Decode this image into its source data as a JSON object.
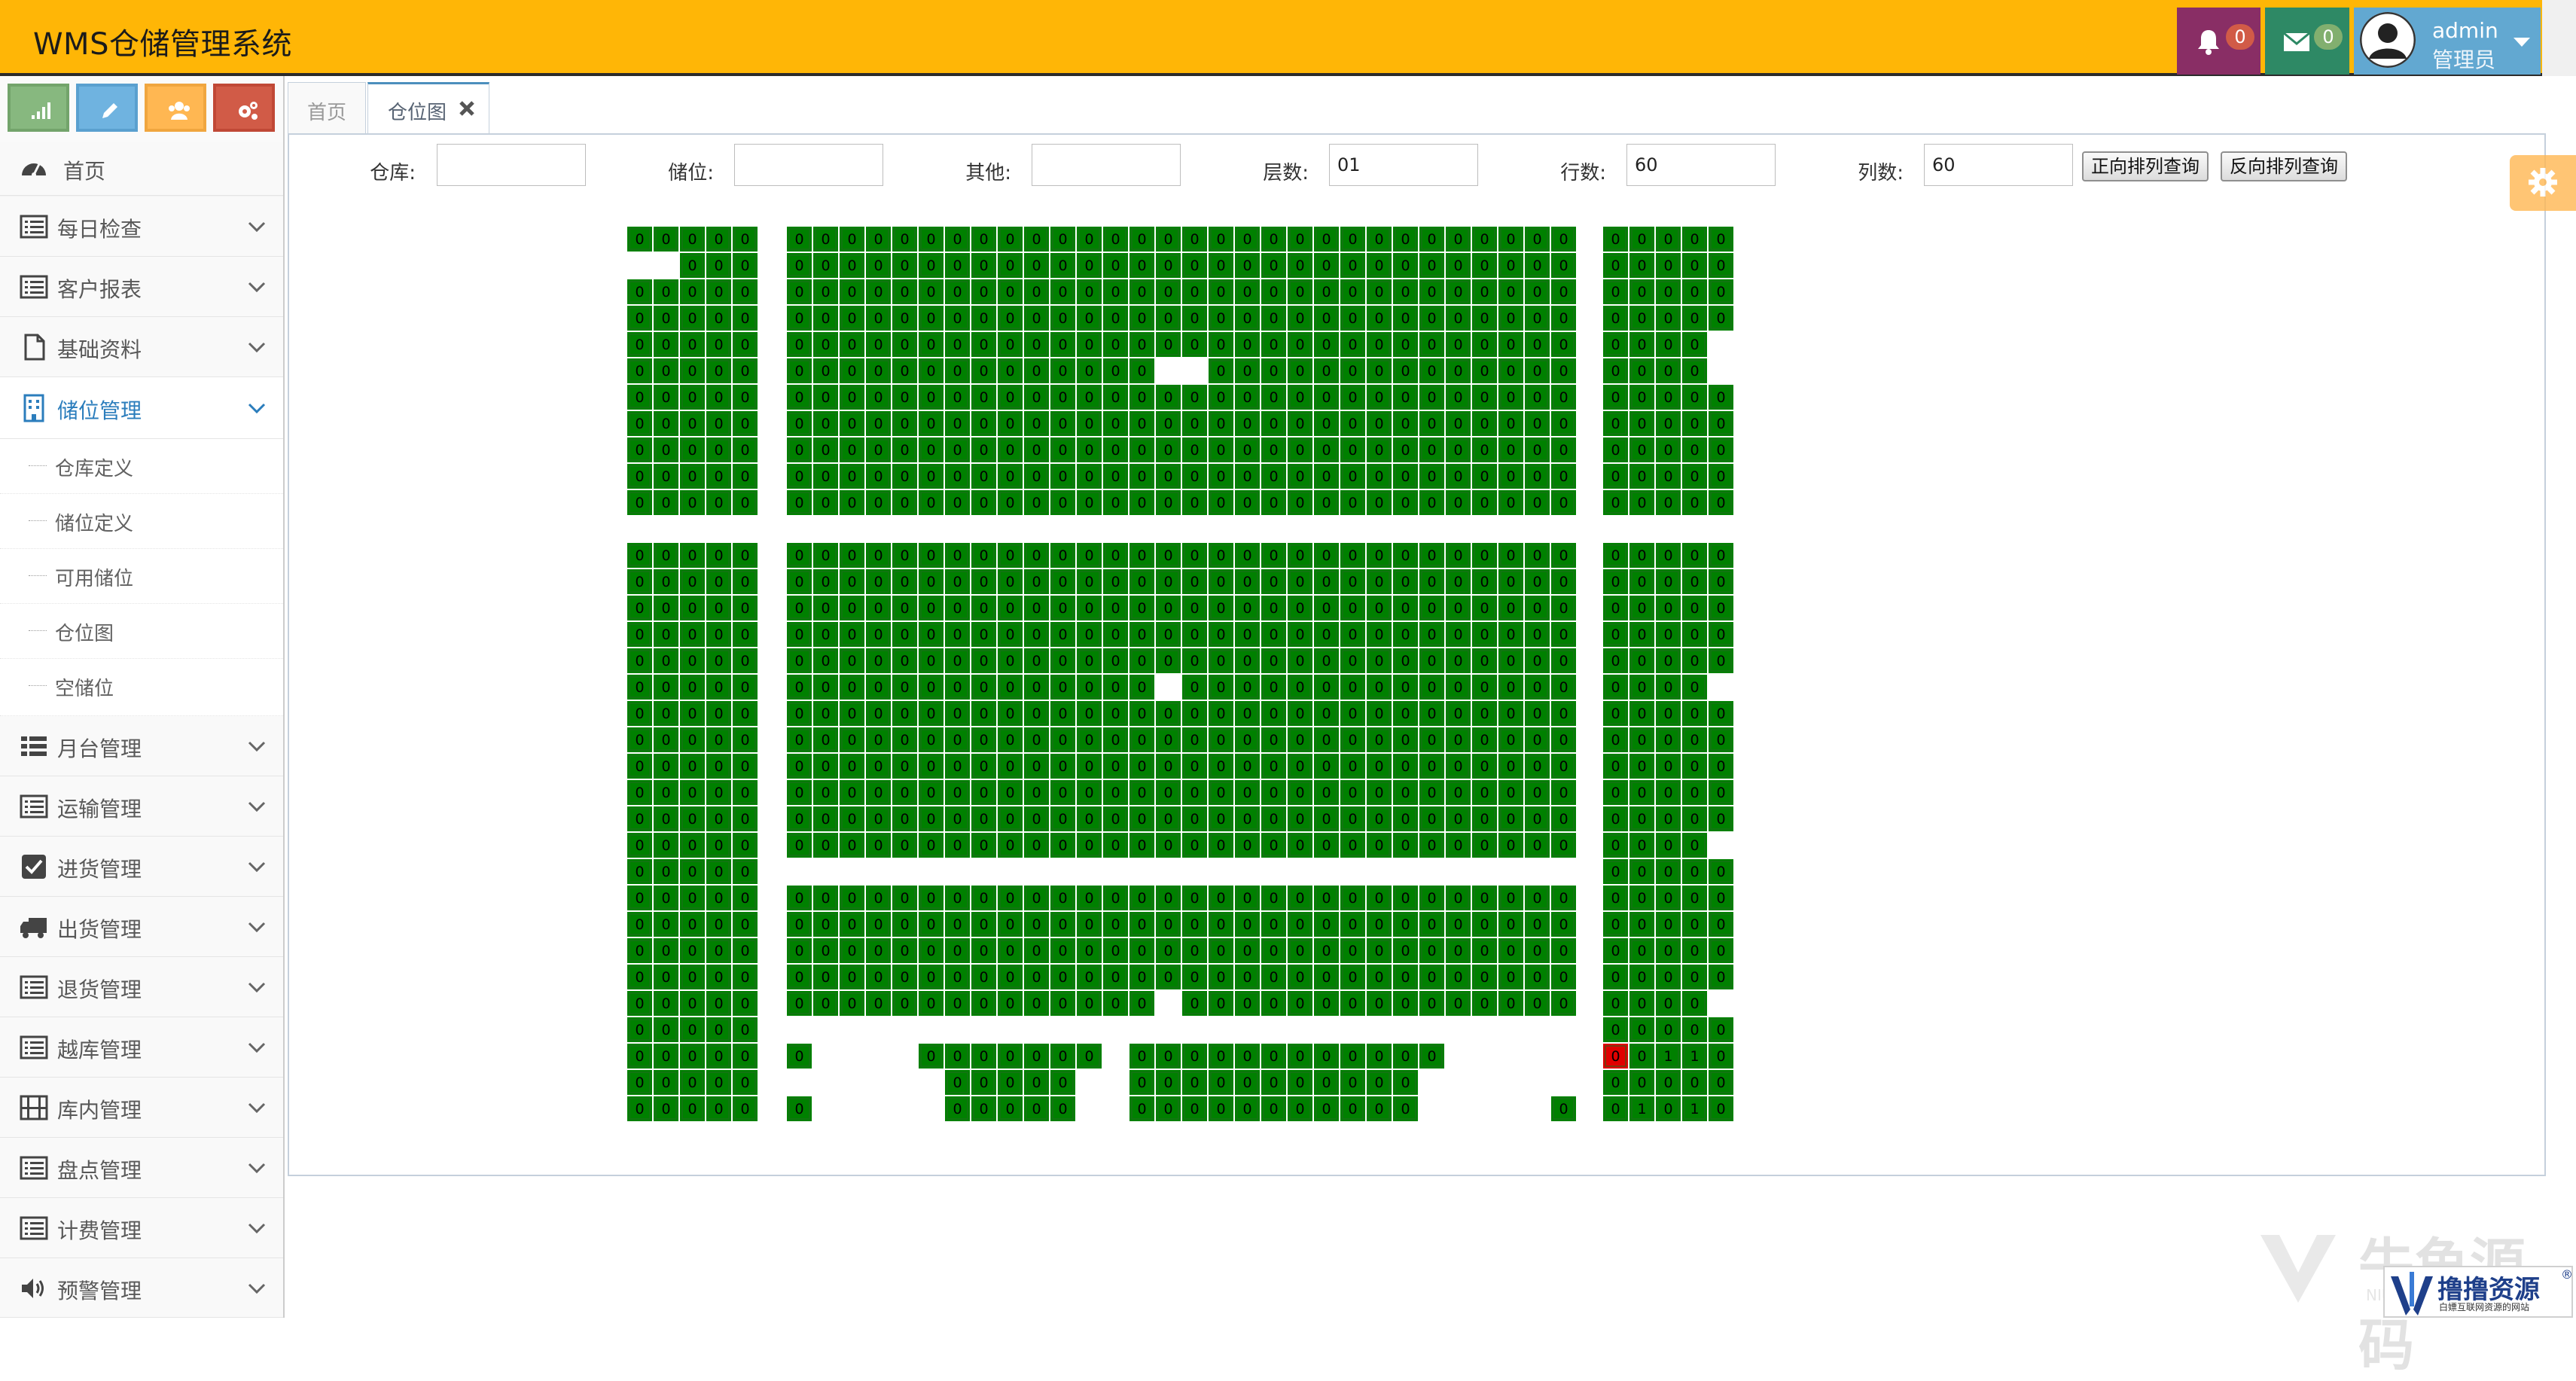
{
  "app": {
    "title": "WMS仓储管理系统"
  },
  "header": {
    "notifications_count": "0",
    "messages_count": "0",
    "user": {
      "name": "admin",
      "role": "管理员"
    },
    "icons": [
      "bell-icon",
      "envelope-icon",
      "user-avatar-icon",
      "caret-down-icon"
    ],
    "colors": {
      "bar": "#ffb606",
      "bell_box": "#892e65",
      "mail_box": "#2e8965",
      "user_box": "#62a8d1"
    }
  },
  "sidebar": {
    "shortcuts": [
      {
        "icon": "signal-icon",
        "color": "#87b87f"
      },
      {
        "icon": "pencil-icon",
        "color": "#6fb3e0"
      },
      {
        "icon": "users-icon",
        "color": "#ffb752"
      },
      {
        "icon": "cogs-icon",
        "color": "#d15b47"
      }
    ],
    "items": [
      {
        "label": "首页",
        "icon": "dashboard-icon"
      },
      {
        "label": "每日检查",
        "icon": "list-alt-icon"
      },
      {
        "label": "客户报表",
        "icon": "list-alt-icon"
      },
      {
        "label": "基础资料",
        "icon": "file-icon"
      },
      {
        "label": "储位管理",
        "icon": "building-icon"
      },
      {
        "label": "月台管理",
        "icon": "list-icon"
      },
      {
        "label": "运输管理",
        "icon": "list-alt-icon"
      },
      {
        "label": "进货管理",
        "icon": "check-square-icon"
      },
      {
        "label": "出货管理",
        "icon": "truck-icon"
      },
      {
        "label": "退货管理",
        "icon": "list-alt-icon"
      },
      {
        "label": "越库管理",
        "icon": "list-alt-icon"
      },
      {
        "label": "库内管理",
        "icon": "film-icon"
      },
      {
        "label": "盘点管理",
        "icon": "list-alt-icon"
      },
      {
        "label": "计费管理",
        "icon": "list-alt-icon"
      },
      {
        "label": "预警管理",
        "icon": "volume-up-icon"
      }
    ],
    "submenu": [
      "仓库定义",
      "储位定义",
      "可用储位",
      "仓位图",
      "空储位"
    ],
    "active_item": "储位管理"
  },
  "tabs": [
    {
      "label": "首页"
    },
    {
      "label": "仓位图"
    }
  ],
  "filters": {
    "warehouse_label": "仓库:",
    "warehouse_value": "",
    "bin_label": "储位:",
    "bin_value": "",
    "other_label": "其他:",
    "other_value": "",
    "layers_label": "层数:",
    "layers_value": "01",
    "rows_label": "行数:",
    "rows_value": "60",
    "cols_label": "列数:",
    "cols_value": "60",
    "forward_button": "正向排列查询",
    "reverse_button": "反向排列查询"
  },
  "location_map": {
    "cell_text": "0",
    "special_cell_text": "1",
    "occupied_color": "#008000",
    "alert_color": "#e00000",
    "blocks": [
      {
        "cols": 5,
        "rows": 11,
        "missing": [
          [
            1,
            0
          ],
          [
            1,
            1
          ]
        ],
        "special": []
      },
      {
        "cols": 30,
        "rows": 11,
        "missing": [
          [
            5,
            14
          ],
          [
            5,
            15
          ]
        ],
        "special": []
      },
      {
        "cols": 5,
        "rows": 11,
        "missing": [
          [
            4,
            4
          ],
          [
            5,
            4
          ]
        ],
        "special": []
      },
      {
        "cols": 5,
        "rows": 22,
        "missing": [],
        "special": []
      },
      {
        "cols": 30,
        "rows": 22,
        "missing": [
          [
            5,
            14
          ],
          [
            12,
            0
          ],
          [
            12,
            1
          ],
          [
            12,
            2
          ],
          [
            12,
            3
          ],
          [
            12,
            4
          ],
          [
            12,
            5
          ],
          [
            12,
            6
          ],
          [
            12,
            7
          ],
          [
            12,
            8
          ],
          [
            12,
            9
          ],
          [
            12,
            10
          ],
          [
            12,
            11
          ],
          [
            12,
            12
          ],
          [
            12,
            13
          ],
          [
            12,
            14
          ],
          [
            12,
            15
          ],
          [
            12,
            16
          ],
          [
            12,
            17
          ],
          [
            12,
            18
          ],
          [
            12,
            19
          ],
          [
            12,
            20
          ],
          [
            12,
            21
          ],
          [
            12,
            22
          ],
          [
            12,
            23
          ],
          [
            12,
            24
          ],
          [
            12,
            25
          ],
          [
            12,
            26
          ],
          [
            12,
            27
          ],
          [
            12,
            28
          ],
          [
            12,
            29
          ],
          [
            17,
            14
          ],
          [
            18,
            0
          ],
          [
            18,
            1
          ],
          [
            18,
            2
          ],
          [
            18,
            3
          ],
          [
            18,
            4
          ],
          [
            18,
            5
          ],
          [
            18,
            6
          ],
          [
            18,
            7
          ],
          [
            18,
            8
          ],
          [
            18,
            9
          ],
          [
            18,
            10
          ],
          [
            18,
            11
          ],
          [
            18,
            12
          ],
          [
            18,
            13
          ],
          [
            18,
            14
          ],
          [
            18,
            15
          ],
          [
            18,
            16
          ],
          [
            18,
            17
          ],
          [
            18,
            18
          ],
          [
            18,
            19
          ],
          [
            18,
            20
          ],
          [
            18,
            21
          ],
          [
            18,
            22
          ],
          [
            18,
            23
          ],
          [
            18,
            24
          ],
          [
            18,
            25
          ],
          [
            18,
            26
          ],
          [
            18,
            27
          ],
          [
            18,
            28
          ],
          [
            18,
            29
          ],
          [
            19,
            1
          ],
          [
            19,
            2
          ],
          [
            19,
            3
          ],
          [
            19,
            4
          ],
          [
            19,
            12
          ],
          [
            19,
            25
          ],
          [
            19,
            26
          ],
          [
            19,
            27
          ],
          [
            19,
            28
          ],
          [
            19,
            29
          ],
          [
            20,
            0
          ],
          [
            20,
            1
          ],
          [
            20,
            2
          ],
          [
            20,
            3
          ],
          [
            20,
            4
          ],
          [
            20,
            5
          ],
          [
            20,
            11
          ],
          [
            20,
            12
          ],
          [
            20,
            24
          ],
          [
            20,
            25
          ],
          [
            20,
            26
          ],
          [
            20,
            27
          ],
          [
            20,
            28
          ],
          [
            20,
            29
          ],
          [
            21,
            1
          ],
          [
            21,
            2
          ],
          [
            21,
            3
          ],
          [
            21,
            4
          ],
          [
            21,
            5
          ],
          [
            21,
            11
          ],
          [
            21,
            12
          ],
          [
            21,
            24
          ],
          [
            21,
            25
          ],
          [
            21,
            26
          ],
          [
            21,
            27
          ],
          [
            21,
            28
          ]
        ],
        "special": []
      },
      {
        "cols": 5,
        "rows": 22,
        "missing": [
          [
            5,
            4
          ],
          [
            11,
            4
          ],
          [
            17,
            4
          ]
        ],
        "special": [
          [
            19,
            2
          ],
          [
            19,
            3
          ],
          [
            21,
            1
          ],
          [
            21,
            3
          ]
        ],
        "alert": [
          [
            19,
            0
          ]
        ]
      }
    ]
  }
}
